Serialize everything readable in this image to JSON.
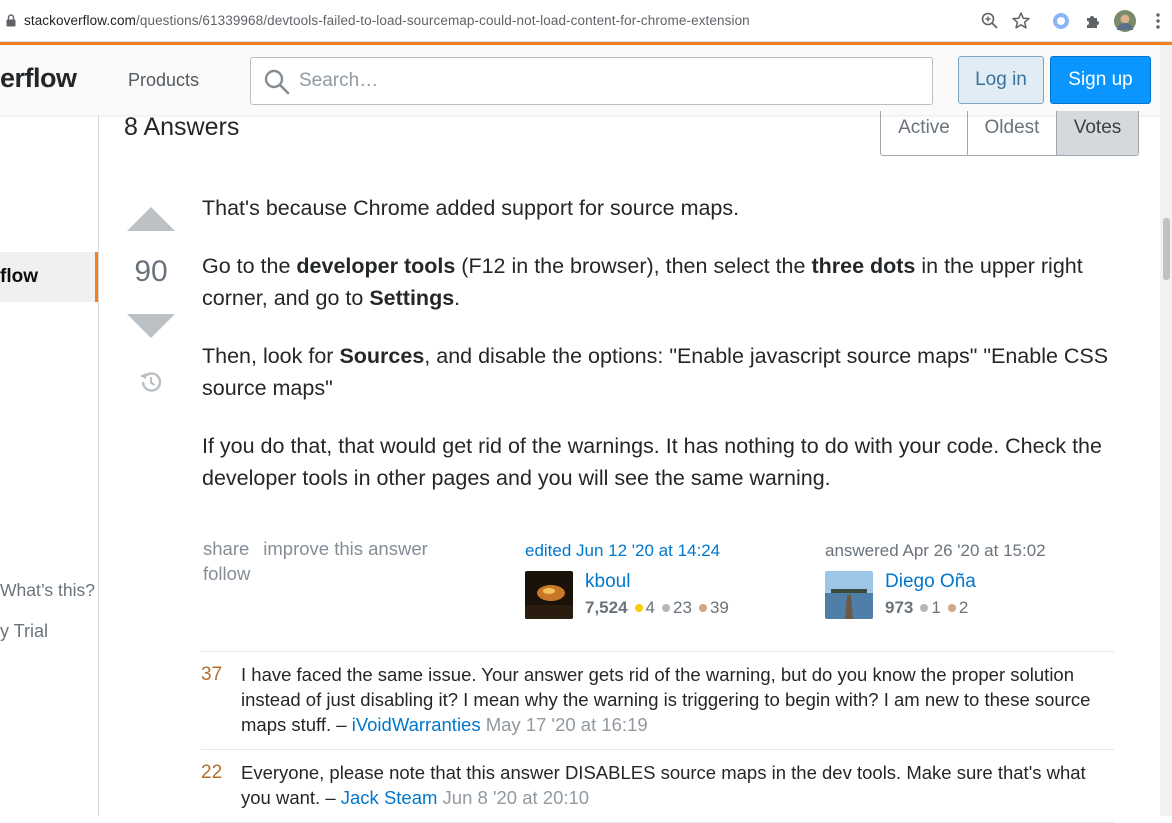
{
  "browser": {
    "url_host": "stackoverflow.com",
    "url_path": "/questions/61339968/devtools-failed-to-load-sourcemap-could-not-load-content-for-chrome-extension"
  },
  "header": {
    "logo_text": "erflow",
    "products_label": "Products",
    "search_placeholder": "Search…",
    "login_label": "Log in",
    "signup_label": "Sign up"
  },
  "sidebar": {
    "selected_item": "flow",
    "whats_this": "What’s this?",
    "trial": "y Trial"
  },
  "answers": {
    "title": "8 Answers",
    "tabs": [
      {
        "label": "Active",
        "selected": false
      },
      {
        "label": "Oldest",
        "selected": false
      },
      {
        "label": "Votes",
        "selected": true
      }
    ]
  },
  "answer": {
    "score": "90",
    "p1": "That's because Chrome added support for source maps.",
    "p2": {
      "t1": "Go to the ",
      "b1": "developer tools",
      "t2": " (F12 in the browser), then select the ",
      "b2": "three dots",
      "t3": " in the upper right corner, and go to ",
      "b3": "Settings",
      "t4": "."
    },
    "p3": {
      "t1": "Then, look for ",
      "b1": "Sources",
      "t2": ", and disable the options: \"Enable javascript source maps\" \"Enable CSS source maps\""
    },
    "p4": "If you do that, that would get rid of the warnings. It has nothing to do with your code. Check the developer tools in other pages and you will see the same warning.",
    "menu": {
      "share": "share",
      "improve": "improve this answer",
      "follow": "follow"
    },
    "editor": {
      "action": "edited Jun 12 '20 at 14:24",
      "name": "kboul",
      "rep": "7,524",
      "gold": "4",
      "silver": "23",
      "bronze": "39"
    },
    "author": {
      "action": "answered Apr 26 '20 at 15:02",
      "name": "Diego Oña",
      "rep": "973",
      "silver": "1",
      "bronze": "2"
    }
  },
  "comments": [
    {
      "score": "37",
      "text": "I have faced the same issue. Your answer gets rid of the warning, but do you know the proper solution instead of just disabling it? I mean why the warning is triggering to begin with? I am new to these source maps stuff. – ",
      "user": "iVoidWarranties",
      "date": " May 17 '20 at 16:19"
    },
    {
      "score": "22",
      "text": "Everyone, please note that this answer DISABLES source maps in the dev tools. Make sure that's what you want. – ",
      "user": "Jack Steam",
      "date": " Jun 8 '20 at 20:10"
    }
  ],
  "colors": {
    "accent_orange": "#f48024",
    "link_blue": "#0077cc",
    "gold_badge": "#ffcc01",
    "silver_badge": "#b4b8bc",
    "bronze_badge": "#d1a684"
  }
}
